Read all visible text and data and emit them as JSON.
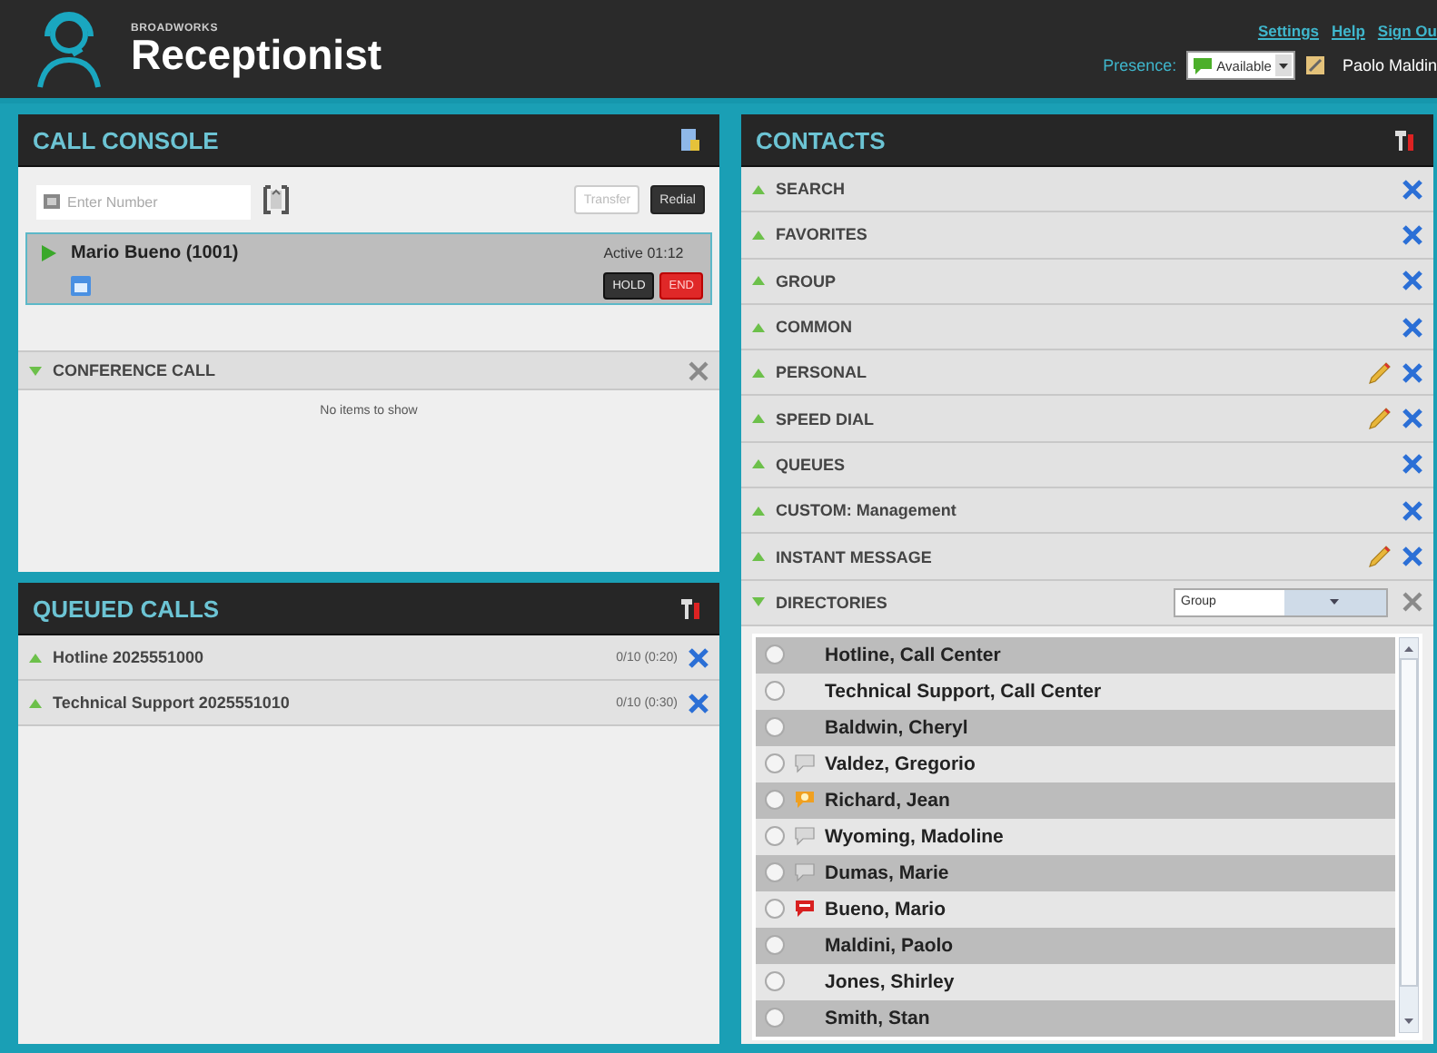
{
  "header": {
    "brand_small": "BROADWORKS",
    "brand": "Receptionist",
    "links": [
      "Settings",
      "Help",
      "Sign Ou"
    ],
    "presence_label": "Presence:",
    "presence_value": "Available",
    "user": "Paolo Maldin"
  },
  "call_console": {
    "title": "CALL CONSOLE",
    "dial_placeholder": "Enter Number",
    "transfer": "Transfer",
    "redial": "Redial",
    "calls": [
      {
        "name": "Mario Bueno (1001)",
        "status": "Active 01:12",
        "hold": "HOLD",
        "end": "END",
        "selected": true
      }
    ],
    "conference": {
      "title": "CONFERENCE CALL",
      "expanded": true,
      "empty": "No items to show"
    }
  },
  "queued_calls": {
    "title": "QUEUED CALLS",
    "queues": [
      {
        "name": "Hotline 2025551000",
        "count": "0/10 (0:20)",
        "expanded": false
      },
      {
        "name": "Technical Support 2025551010",
        "count": "0/10 (0:30)",
        "expanded": false
      }
    ]
  },
  "contacts": {
    "title": "CONTACTS",
    "sections": [
      {
        "label": "SEARCH",
        "expanded": false,
        "editable": false
      },
      {
        "label": "FAVORITES",
        "expanded": false,
        "editable": false
      },
      {
        "label": "GROUP",
        "expanded": false,
        "editable": false
      },
      {
        "label": "COMMON",
        "expanded": false,
        "editable": false
      },
      {
        "label": "PERSONAL",
        "expanded": false,
        "editable": true
      },
      {
        "label": "SPEED DIAL",
        "expanded": false,
        "editable": true
      },
      {
        "label": "QUEUES",
        "expanded": false,
        "editable": false
      },
      {
        "label": "CUSTOM: Management",
        "expanded": false,
        "editable": false
      },
      {
        "label": "INSTANT MESSAGE",
        "expanded": false,
        "editable": true
      },
      {
        "label": "DIRECTORIES",
        "expanded": true,
        "editable": false,
        "filter": "Group"
      }
    ],
    "entries": [
      {
        "name": "Hotline, Call Center",
        "kind": "plain"
      },
      {
        "name": "Technical Support, Call Center",
        "kind": "plain"
      },
      {
        "name": "Baldwin, Cheryl",
        "kind": "plain"
      },
      {
        "name": "Valdez, Gregorio",
        "kind": "offline"
      },
      {
        "name": "Richard, Jean",
        "kind": "away"
      },
      {
        "name": "Wyoming, Madoline",
        "kind": "offline"
      },
      {
        "name": "Dumas, Marie",
        "kind": "offline"
      },
      {
        "name": "Bueno, Mario",
        "kind": "busy"
      },
      {
        "name": "Maldini, Paolo",
        "kind": "plain"
      },
      {
        "name": "Jones, Shirley",
        "kind": "plain"
      },
      {
        "name": "Smith, Stan",
        "kind": "plain"
      }
    ]
  }
}
